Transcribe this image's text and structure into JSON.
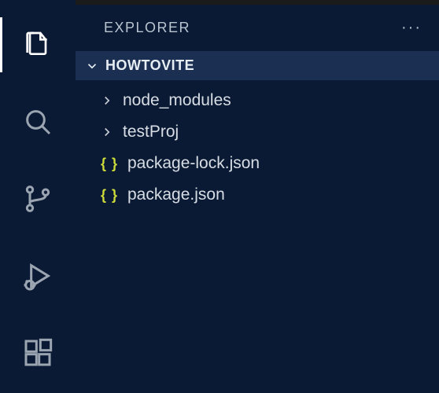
{
  "sidebar": {
    "title": "EXPLORER",
    "more_icon": "···",
    "section_title": "HOWTOVITE"
  },
  "tree": {
    "items": [
      {
        "type": "folder",
        "name": "node_modules"
      },
      {
        "type": "folder",
        "name": "testProj"
      },
      {
        "type": "file",
        "name": "package-lock.json",
        "icon": "{ }"
      },
      {
        "type": "file",
        "name": "package.json",
        "icon": "{ }"
      }
    ]
  },
  "activity": {
    "items": [
      {
        "id": "explorer",
        "active": true
      },
      {
        "id": "search",
        "active": false
      },
      {
        "id": "scm",
        "active": false
      },
      {
        "id": "debug",
        "active": false
      },
      {
        "id": "extensions",
        "active": false
      }
    ]
  }
}
